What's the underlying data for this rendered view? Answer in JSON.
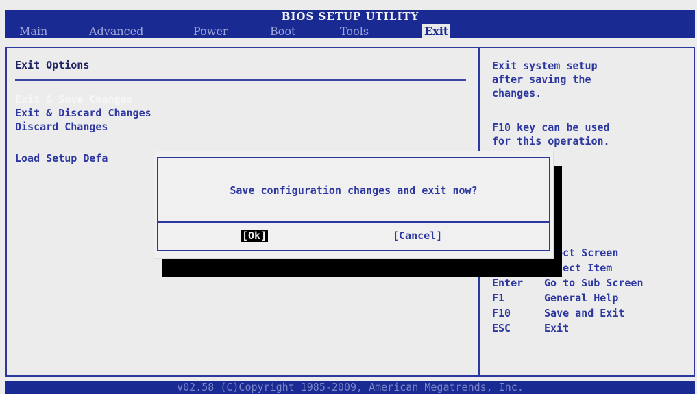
{
  "header": {
    "title": "BIOS SETUP UTILITY",
    "tabs": [
      {
        "label": "Main"
      },
      {
        "label": "Advanced"
      },
      {
        "label": "Power"
      },
      {
        "label": "Boot"
      },
      {
        "label": "Tools"
      },
      {
        "label": "Exit"
      }
    ],
    "active_tab": "Exit"
  },
  "main": {
    "section_title": "Exit Options",
    "options": [
      {
        "label": "Exit & Save Changes",
        "selected": true
      },
      {
        "label": "Exit & Discard Changes",
        "selected": false
      },
      {
        "label": "Discard Changes",
        "selected": false
      },
      {
        "label": "Load Setup Defa",
        "selected": false
      }
    ]
  },
  "help": {
    "description": "Exit system setup\nafter saving the\nchanges.",
    "note": "F10 key can be used\nfor this operation.",
    "keys": [
      {
        "key": "",
        "action": "elect Screen"
      },
      {
        "key": "↑↓",
        "action": "Select Item"
      },
      {
        "key": "Enter",
        "action": "Go to Sub Screen"
      },
      {
        "key": "F1",
        "action": "General Help"
      },
      {
        "key": "F10",
        "action": "Save and Exit"
      },
      {
        "key": "ESC",
        "action": "Exit"
      }
    ]
  },
  "dialog": {
    "message": "Save configuration changes and exit now?",
    "ok_label": "[Ok]",
    "cancel_label": "[Cancel]",
    "focused": "ok"
  },
  "footer": {
    "text": "v02.58 (C)Copyright 1985-2009, American Megatrends, Inc."
  },
  "colors": {
    "bar_blue": "#1a2a93",
    "text_blue": "#2c37a0",
    "background": "#ececec",
    "selected_text": "#f6f6f6"
  }
}
